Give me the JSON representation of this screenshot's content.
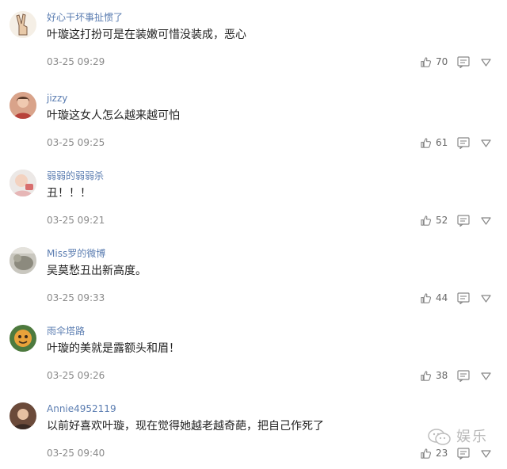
{
  "comments": [
    {
      "username": "好心干坏事扯惯了",
      "content": "叶璇这打扮可是在装嫩可惜没装成，恶心",
      "time": "03-25 09:29",
      "likes": "70",
      "avatar": "hand-peace-avatar"
    },
    {
      "username": "jizzy",
      "content": "叶璇这女人怎么越来越可怕",
      "time": "03-25 09:25",
      "likes": "61",
      "avatar": "photo-avatar"
    },
    {
      "username": "弱弱的弱弱杀",
      "content": "丑！！！",
      "time": "03-25 09:21",
      "likes": "52",
      "avatar": "baby-avatar"
    },
    {
      "username": "Miss罗的微博",
      "content": "吴莫愁丑出新高度。",
      "time": "03-25 09:33",
      "likes": "44",
      "avatar": "animal-avatar"
    },
    {
      "username": "雨伞塔路",
      "content": "叶璇的美就是露额头和眉！",
      "time": "03-25 09:26",
      "likes": "38",
      "avatar": "cartoon-avatar"
    },
    {
      "username": "Annie4952119",
      "content": "以前好喜欢叶璇，现在觉得她越老越奇葩，把自己作死了",
      "time": "03-25 09:40",
      "likes": "23",
      "avatar": "portrait-avatar"
    }
  ],
  "watermark": {
    "text": "娱乐",
    "icon": "wechat-icon"
  },
  "colors": {
    "username": "#5b7db1",
    "text": "#222222",
    "meta": "#8a8a8a",
    "icon": "#888888"
  }
}
